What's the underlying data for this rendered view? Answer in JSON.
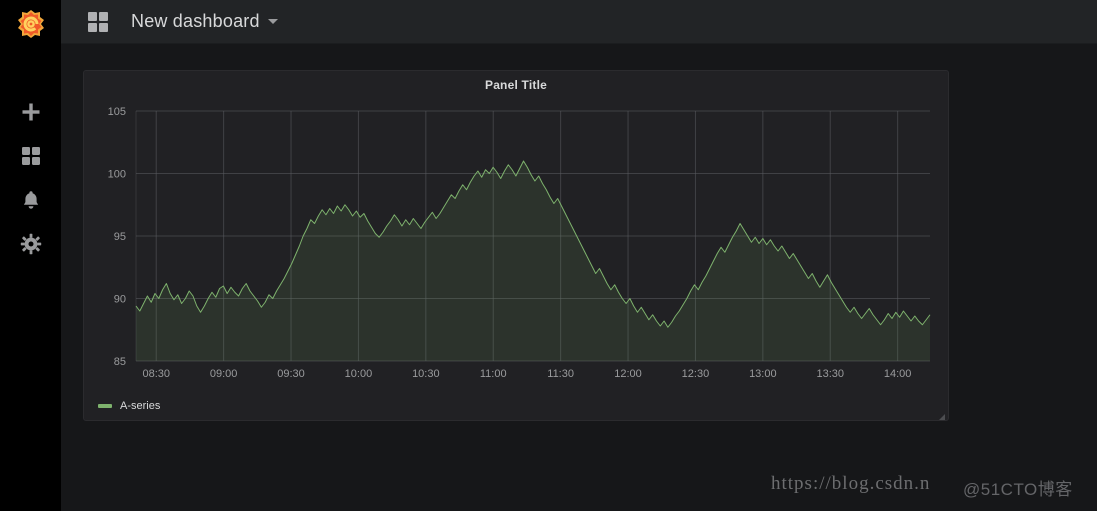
{
  "sidebar": {
    "brand_icon": "grafana-logo-icon",
    "items": [
      {
        "icon": "plus-icon",
        "label": "Create"
      },
      {
        "icon": "dashboards-grid-icon",
        "label": "Dashboards"
      },
      {
        "icon": "bell-icon",
        "label": "Alerting"
      },
      {
        "icon": "gear-icon",
        "label": "Configuration"
      }
    ]
  },
  "navbar": {
    "dashboard_icon": "dashboard-grid-icon",
    "title": "New dashboard",
    "caret_icon": "chevron-down-icon"
  },
  "panel": {
    "title": "Panel Title",
    "resize_handle_icon": "resize-handle-icon"
  },
  "watermark": {
    "url": "https://blog.csdn.n",
    "author": "@51CTO博客"
  },
  "colors": {
    "series_green": "#7eb26d",
    "panel_bg": "#212124",
    "page_bg": "#161719",
    "grid": "#5a5c61",
    "text": "#d8d9da",
    "axis_text": "#9a9b9d"
  },
  "chart_data": {
    "type": "area",
    "title": "Panel Title",
    "xlabel": "",
    "ylabel": "",
    "ylim": [
      85,
      105
    ],
    "yticks": [
      85,
      90,
      95,
      100,
      105
    ],
    "xticks": [
      "08:30",
      "09:00",
      "09:30",
      "10:00",
      "10:30",
      "11:00",
      "11:30",
      "12:00",
      "12:30",
      "13:00",
      "13:30",
      "14:00"
    ],
    "x_start": "08:22",
    "x_end": "14:18",
    "grid": true,
    "legend_position": "bottom-left",
    "fill_opacity": 0.12,
    "line_width": 1,
    "series": [
      {
        "name": "A-series",
        "color": "#7eb26d",
        "values": [
          89.4,
          89.0,
          89.6,
          90.2,
          89.7,
          90.4,
          90.0,
          90.7,
          91.2,
          90.4,
          89.9,
          90.3,
          89.6,
          90.0,
          90.6,
          90.2,
          89.4,
          88.9,
          89.4,
          90.0,
          90.5,
          90.1,
          90.8,
          91.0,
          90.4,
          90.9,
          90.5,
          90.2,
          90.8,
          91.2,
          90.6,
          90.2,
          89.8,
          89.3,
          89.7,
          90.3,
          90.0,
          90.6,
          91.1,
          91.6,
          92.2,
          92.8,
          93.5,
          94.2,
          95.0,
          95.6,
          96.3,
          96.0,
          96.6,
          97.1,
          96.7,
          97.2,
          96.8,
          97.4,
          97.0,
          97.5,
          97.1,
          96.6,
          97.0,
          96.5,
          96.8,
          96.2,
          95.7,
          95.2,
          94.9,
          95.3,
          95.8,
          96.2,
          96.7,
          96.3,
          95.8,
          96.3,
          95.9,
          96.4,
          96.0,
          95.6,
          96.1,
          96.5,
          96.9,
          96.4,
          96.8,
          97.3,
          97.8,
          98.3,
          98.0,
          98.6,
          99.1,
          98.7,
          99.3,
          99.8,
          100.2,
          99.7,
          100.3,
          100.0,
          100.5,
          100.1,
          99.6,
          100.2,
          100.7,
          100.3,
          99.8,
          100.4,
          101.0,
          100.5,
          99.9,
          99.4,
          99.8,
          99.2,
          98.7,
          98.1,
          97.6,
          98.0,
          97.4,
          96.8,
          96.2,
          95.6,
          95.0,
          94.4,
          93.8,
          93.2,
          92.6,
          92.0,
          92.4,
          91.8,
          91.2,
          90.7,
          91.1,
          90.5,
          90.0,
          89.6,
          90.0,
          89.4,
          88.9,
          89.3,
          88.8,
          88.3,
          88.7,
          88.2,
          87.8,
          88.2,
          87.7,
          88.1,
          88.6,
          89.0,
          89.5,
          90.0,
          90.6,
          91.1,
          90.7,
          91.3,
          91.8,
          92.4,
          93.0,
          93.6,
          94.1,
          93.7,
          94.3,
          94.9,
          95.4,
          96.0,
          95.5,
          95.0,
          94.5,
          94.9,
          94.4,
          94.8,
          94.3,
          94.7,
          94.2,
          93.8,
          94.2,
          93.7,
          93.2,
          93.6,
          93.1,
          92.6,
          92.1,
          91.6,
          92.0,
          91.4,
          90.9,
          91.4,
          91.9,
          91.3,
          90.8,
          90.3,
          89.8,
          89.3,
          88.9,
          89.3,
          88.8,
          88.4,
          88.8,
          89.2,
          88.7,
          88.3,
          87.9,
          88.3,
          88.8,
          88.4,
          88.9,
          88.5,
          89.0,
          88.6,
          88.2,
          88.6,
          88.2,
          87.9,
          88.3,
          88.7
        ]
      }
    ]
  }
}
